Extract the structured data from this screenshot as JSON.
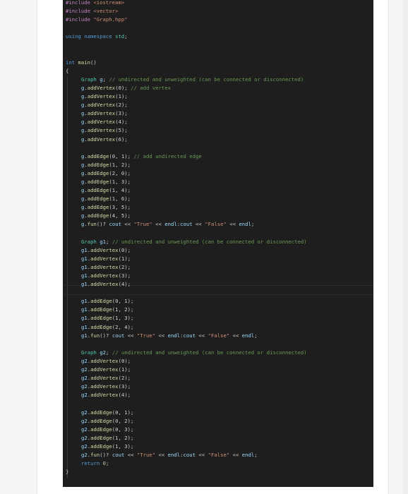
{
  "code": {
    "includes": [
      {
        "directive": "#include",
        "target": "<iostream>"
      },
      {
        "directive": "#include",
        "target": "<vector>"
      },
      {
        "directive": "#include",
        "target": "\"Graph.hpp\""
      }
    ],
    "using_line": {
      "kw1": "using",
      "kw2": "namespace",
      "name": "std",
      "end": ";"
    },
    "main_sig": {
      "type": "int",
      "name": "main",
      "rest": "()"
    },
    "open_brace": "{",
    "close_brace": "}",
    "blocks": [
      {
        "decl": {
          "type": "Graph",
          "var": "g",
          "end": ";",
          "comment": "// undirected and unweighted (can be connected or disconnected)"
        },
        "vertices": [
          {
            "obj": "g",
            "call": "addVertex",
            "args": "(0);",
            "comment": "// add vertex"
          },
          {
            "obj": "g",
            "call": "addVertex",
            "args": "(1);",
            "comment": ""
          },
          {
            "obj": "g",
            "call": "addVertex",
            "args": "(2);",
            "comment": ""
          },
          {
            "obj": "g",
            "call": "addVertex",
            "args": "(3);",
            "comment": ""
          },
          {
            "obj": "g",
            "call": "addVertex",
            "args": "(4);",
            "comment": ""
          },
          {
            "obj": "g",
            "call": "addVertex",
            "args": "(5);",
            "comment": ""
          },
          {
            "obj": "g",
            "call": "addVertex",
            "args": "(6);",
            "comment": ""
          }
        ],
        "edges": [
          {
            "obj": "g",
            "call": "addEdge",
            "args": "(0, 1);",
            "comment": "// add undirected edge"
          },
          {
            "obj": "g",
            "call": "addEdge",
            "args": "(1, 2);",
            "comment": ""
          },
          {
            "obj": "g",
            "call": "addEdge",
            "args": "(2, 0);",
            "comment": ""
          },
          {
            "obj": "g",
            "call": "addEdge",
            "args": "(1, 3);",
            "comment": ""
          },
          {
            "obj": "g",
            "call": "addEdge",
            "args": "(1, 4);",
            "comment": ""
          },
          {
            "obj": "g",
            "call": "addEdge",
            "args": "(1, 6);",
            "comment": ""
          },
          {
            "obj": "g",
            "call": "addEdge",
            "args": "(3, 5);",
            "comment": ""
          },
          {
            "obj": "g",
            "call": "addEdge",
            "args": "(4, 5);",
            "comment": ""
          }
        ],
        "fun": {
          "obj": "g",
          "call": "fun",
          "a": "()? ",
          "cout1": "cout",
          "op1": " << ",
          "true": "\"True\"",
          "op2": " << ",
          "endl1": "endl",
          "colon": ":",
          "cout2": "cout",
          "op3": " << ",
          "false": "\"False\"",
          "op4": " << ",
          "endl2": "endl",
          "end": ";"
        }
      },
      {
        "decl": {
          "type": "Graph",
          "var": "g1",
          "end": ";",
          "comment": "// undirected and unweighted (can be connected or disconnected)"
        },
        "vertices": [
          {
            "obj": "g1",
            "call": "addVertex",
            "args": "(0);",
            "comment": ""
          },
          {
            "obj": "g1",
            "call": "addVertex",
            "args": "(1);",
            "comment": ""
          },
          {
            "obj": "g1",
            "call": "addVertex",
            "args": "(2);",
            "comment": ""
          },
          {
            "obj": "g1",
            "call": "addVertex",
            "args": "(3);",
            "comment": ""
          },
          {
            "obj": "g1",
            "call": "addVertex",
            "args": "(4);",
            "comment": ""
          }
        ],
        "edges": [
          {
            "obj": "g1",
            "call": "addEdge",
            "args": "(0, 1);",
            "comment": ""
          },
          {
            "obj": "g1",
            "call": "addEdge",
            "args": "(1, 2);",
            "comment": ""
          },
          {
            "obj": "g1",
            "call": "addEdge",
            "args": "(1, 3);",
            "comment": ""
          },
          {
            "obj": "g1",
            "call": "addEdge",
            "args": "(2, 4);",
            "comment": ""
          }
        ],
        "fun": {
          "obj": "g1",
          "call": "fun",
          "a": "()? ",
          "cout1": "cout",
          "op1": " << ",
          "true": "\"True\"",
          "op2": " << ",
          "endl1": "endl",
          "colon": ":",
          "cout2": "cout",
          "op3": " << ",
          "false": "\"False\"",
          "op4": " << ",
          "endl2": "endl",
          "end": ";"
        }
      },
      {
        "decl": {
          "type": "Graph",
          "var": "g2",
          "end": ";",
          "comment": "// undirected and unweighted (can be connected or disconnected)"
        },
        "vertices": [
          {
            "obj": "g2",
            "call": "addVertex",
            "args": "(0);",
            "comment": ""
          },
          {
            "obj": "g2",
            "call": "addVertex",
            "args": "(1);",
            "comment": ""
          },
          {
            "obj": "g2",
            "call": "addVertex",
            "args": "(2);",
            "comment": ""
          },
          {
            "obj": "g2",
            "call": "addVertex",
            "args": "(3);",
            "comment": ""
          },
          {
            "obj": "g2",
            "call": "addVertex",
            "args": "(4);",
            "comment": ""
          }
        ],
        "edges": [
          {
            "obj": "g2",
            "call": "addEdge",
            "args": "(0, 1);",
            "comment": ""
          },
          {
            "obj": "g2",
            "call": "addEdge",
            "args": "(0, 2);",
            "comment": ""
          },
          {
            "obj": "g2",
            "call": "addEdge",
            "args": "(0, 3);",
            "comment": ""
          },
          {
            "obj": "g2",
            "call": "addEdge",
            "args": "(1, 2);",
            "comment": ""
          },
          {
            "obj": "g2",
            "call": "addEdge",
            "args": "(1, 3);",
            "comment": ""
          }
        ],
        "fun": {
          "obj": "g2",
          "call": "fun",
          "a": "()? ",
          "cout1": "cout",
          "op1": " << ",
          "true": "\"True\"",
          "op2": " << ",
          "endl1": "endl",
          "colon": ":",
          "cout2": "cout",
          "op3": " << ",
          "false": "\"False\"",
          "op4": " << ",
          "endl2": "endl",
          "end": ";"
        }
      }
    ],
    "return_line": {
      "kw": "return",
      "val": "0",
      "end": ";"
    }
  },
  "colors": {
    "editor_bg": "#1e1e1e",
    "page_bg": "#ffffff",
    "outer_bg": "#f4f5f6"
  }
}
